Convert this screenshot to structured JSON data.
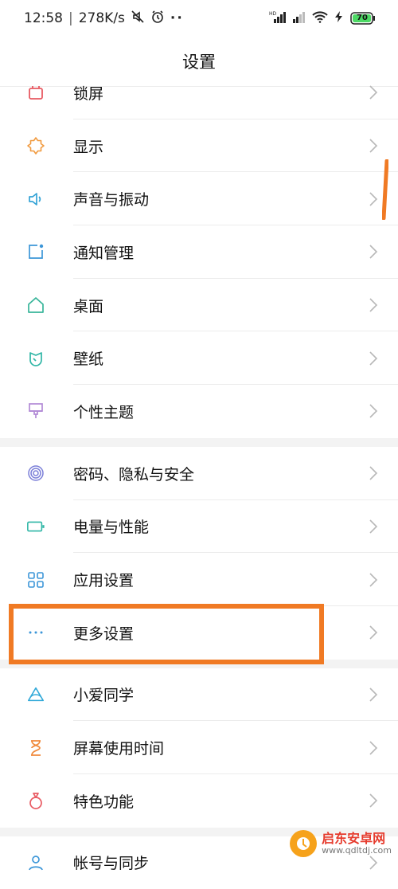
{
  "status_bar": {
    "time": "12:58",
    "speed": "278K/s",
    "battery": "70"
  },
  "title": "设置",
  "groups": [
    {
      "items": [
        {
          "id": "lock-screen",
          "label": "锁屏",
          "icon": "lock-screen-icon",
          "color": "#e85a62"
        },
        {
          "id": "display",
          "label": "显示",
          "icon": "sun-icon",
          "color": "#f19a3e"
        },
        {
          "id": "sound",
          "label": "声音与振动",
          "icon": "speaker-icon",
          "color": "#33a3d6"
        },
        {
          "id": "notification",
          "label": "通知管理",
          "icon": "notification-icon",
          "color": "#3c96d8"
        },
        {
          "id": "home",
          "label": "桌面",
          "icon": "home-icon",
          "color": "#38b59a"
        },
        {
          "id": "wallpaper",
          "label": "壁纸",
          "icon": "wallpaper-icon",
          "color": "#2fb6a6"
        },
        {
          "id": "theme",
          "label": "个性主题",
          "icon": "brush-icon",
          "color": "#b28ad6"
        }
      ]
    },
    {
      "items": [
        {
          "id": "privacy",
          "label": "密码、隐私与安全",
          "icon": "fingerprint-icon",
          "color": "#7b7fd8"
        },
        {
          "id": "battery",
          "label": "电量与性能",
          "icon": "battery-icon",
          "color": "#2fb6a6"
        },
        {
          "id": "apps",
          "label": "应用设置",
          "icon": "apps-grid-icon",
          "color": "#3c96d8"
        },
        {
          "id": "more",
          "label": "更多设置",
          "icon": "more-dots-icon",
          "color": "#3c96d8"
        }
      ]
    },
    {
      "items": [
        {
          "id": "xiaoai",
          "label": "小爱同学",
          "icon": "xiaoai-icon",
          "color": "#2fa8d8"
        },
        {
          "id": "screen-time",
          "label": "屏幕使用时间",
          "icon": "hourglass-icon",
          "color": "#f08a3c"
        },
        {
          "id": "special",
          "label": "特色功能",
          "icon": "special-feature-icon",
          "color": "#e85a62"
        }
      ]
    },
    {
      "items": [
        {
          "id": "account",
          "label": "帐号与同步",
          "icon": "account-icon",
          "color": "#3c96d8"
        }
      ]
    }
  ],
  "watermark": {
    "title": "启东安卓网",
    "url": "www.qdltdj.com"
  },
  "colors": {
    "highlight": "#f07a24",
    "chevron": "#b8b8b8",
    "divider": "#ececec"
  }
}
